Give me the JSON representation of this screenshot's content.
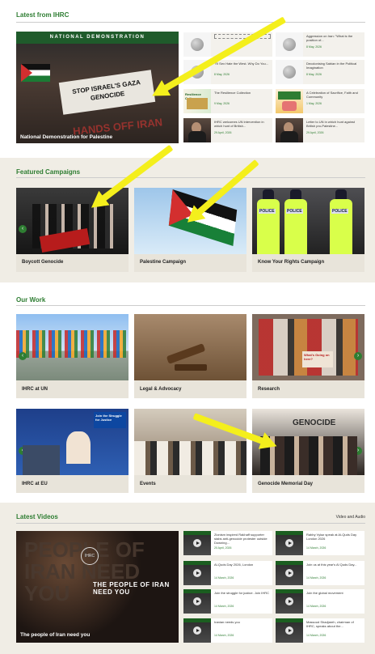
{
  "latest": {
    "title": "Latest from IHRC",
    "hero": {
      "banner": "NATIONAL DEMONSTRATION",
      "sign": "STOP ISRAEL'S GAZA GENOCIDE",
      "overlay_text": "HANDS OFF IRAN",
      "caption": "National Demonstration for Palestine"
    },
    "news": [
      {
        "title": "",
        "date": "",
        "thumb": "coin"
      },
      {
        "title": "Aggression on Iran: \"What is the position of...",
        "date": "8 May, 2026",
        "thumb": "coin"
      },
      {
        "title": "\"I'll Sex Hate the West. Why Do You...",
        "date": "8 May, 2026",
        "thumb": "coin"
      },
      {
        "title": "Decolonising Sabian in the Political Imagination",
        "date": "8 May, 2026",
        "thumb": "coin"
      },
      {
        "title": "The Resilience Collection",
        "date": "9 May, 2026",
        "thumb": "event"
      },
      {
        "title": "A Celebration of Sacrifice, Faith and Community",
        "date": "1 May, 2026",
        "thumb": "kids"
      },
      {
        "title": "IHRC welcomes UN intervention in which hunt of British...",
        "date": "29 April, 2026",
        "thumb": "photo"
      },
      {
        "title": "Letter to UN in which hunt against British pro-Palestine...",
        "date": "29 April, 2026",
        "thumb": "photo"
      }
    ]
  },
  "featured": {
    "title": "Featured Campaigns",
    "cards": [
      {
        "label": "Boycott Genocide"
      },
      {
        "label": "Palestine Campaign"
      },
      {
        "label": "Know Your Rights Campaign"
      }
    ]
  },
  "ourwork": {
    "title": "Our Work",
    "cards": [
      {
        "label": "IHRC at UN"
      },
      {
        "label": "Legal & Advocacy"
      },
      {
        "label": "Research"
      },
      {
        "label": "IHRC at EU"
      },
      {
        "label": "Events"
      },
      {
        "label": "Genocide Memorial Day"
      }
    ],
    "research_sign": "What's Going on here?",
    "eu_sign": "Join the Struggle for Justice"
  },
  "videos": {
    "title": "Latest Videos",
    "link": "Video and Audio",
    "hero": {
      "big_text": "PEOPLE OF IRAN NEED YOU",
      "overlay": "THE PEOPLE OF IRAN NEED YOU",
      "caption": "The people of Iran need you"
    },
    "items": [
      {
        "title": "Zionism inspired Rakhaff supporter stabs anti-genocide protester outside Downing...",
        "date": "20 April, 2026"
      },
      {
        "title": "Rabby Vylaz speak at Al-Quds Day London 2026",
        "date": "14 March, 2026"
      },
      {
        "title": "Al-Quds Day 2026, London",
        "date": "14 March, 2026"
      },
      {
        "title": "Join us at this year's Al Quds Day...",
        "date": "14 March, 2026"
      },
      {
        "title": "Join the struggle for justice. Join IHRC",
        "date": "14 March, 2026"
      },
      {
        "title": "Join the global movement",
        "date": "14 March, 2026"
      },
      {
        "title": "Iranian needs you",
        "date": "14 March, 2026"
      },
      {
        "title": "Massoud Shadjareh, chairman of IHRC, speaks about the...",
        "date": "14 March, 2026"
      }
    ]
  },
  "colors": {
    "accent": "#2e7d32",
    "section_bg": "#f0ede5",
    "annotation_arrow": "#f4ef1c"
  }
}
